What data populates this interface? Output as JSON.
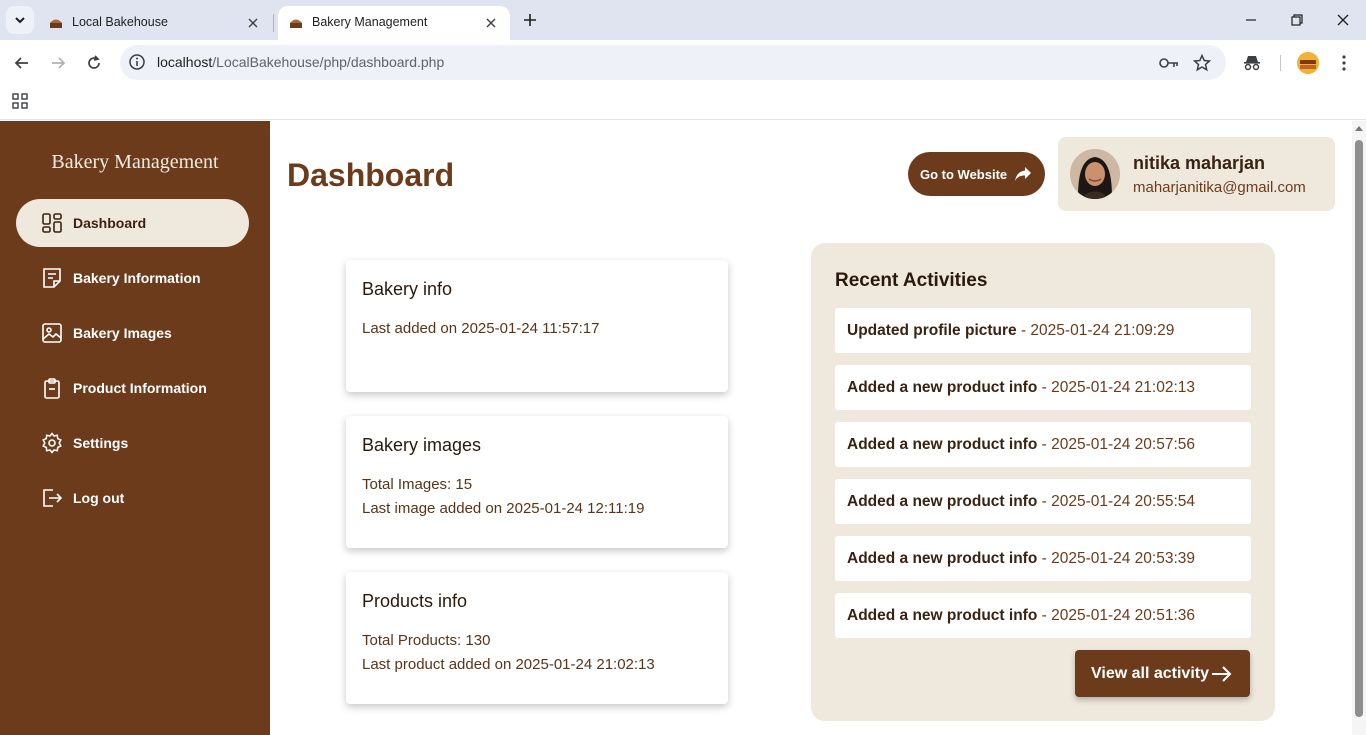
{
  "browser": {
    "tabs": [
      {
        "title": "Local Bakehouse",
        "active": false
      },
      {
        "title": "Bakery Management",
        "active": true
      }
    ],
    "url_host": "localhost",
    "url_path": "/LocalBakehouse/php/dashboard.php"
  },
  "sidebar": {
    "brand": "Bakery Management",
    "items": [
      {
        "label": "Dashboard",
        "icon": "dashboard-icon",
        "active": true
      },
      {
        "label": "Bakery Information",
        "icon": "document-icon",
        "active": false
      },
      {
        "label": "Bakery Images",
        "icon": "image-icon",
        "active": false
      },
      {
        "label": "Product Information",
        "icon": "clipboard-icon",
        "active": false
      },
      {
        "label": "Settings",
        "icon": "gear-icon",
        "active": false
      },
      {
        "label": "Log out",
        "icon": "logout-icon",
        "active": false
      }
    ]
  },
  "header": {
    "title": "Dashboard",
    "goto_label": "Go to Website",
    "user_name": "nitika maharjan",
    "user_email": "maharjanitika@gmail.com"
  },
  "cards": [
    {
      "title": "Bakery info",
      "lines": [
        "Last added on 2025-01-24 11:57:17"
      ]
    },
    {
      "title": "Bakery images",
      "lines": [
        "Total Images: 15",
        "Last image added on 2025-01-24 12:11:19"
      ]
    },
    {
      "title": "Products info",
      "lines": [
        "Total Products: 130",
        "Last product added on 2025-01-24 21:02:13"
      ]
    }
  ],
  "activities": {
    "title": "Recent Activities",
    "items": [
      {
        "action": "Updated profile picture",
        "time": " - 2025-01-24 21:09:29"
      },
      {
        "action": "Added a new product info",
        "time": " - 2025-01-24 21:02:13"
      },
      {
        "action": "Added a new product info",
        "time": " - 2025-01-24 20:57:56"
      },
      {
        "action": "Added a new product info",
        "time": " - 2025-01-24 20:55:54"
      },
      {
        "action": "Added a new product info",
        "time": " - 2025-01-24 20:53:39"
      },
      {
        "action": "Added a new product info",
        "time": " - 2025-01-24 20:51:36"
      }
    ],
    "view_all_label": "View all activity"
  },
  "colors": {
    "brand_brown": "#6b3b1c",
    "cream": "#efe8dc"
  }
}
